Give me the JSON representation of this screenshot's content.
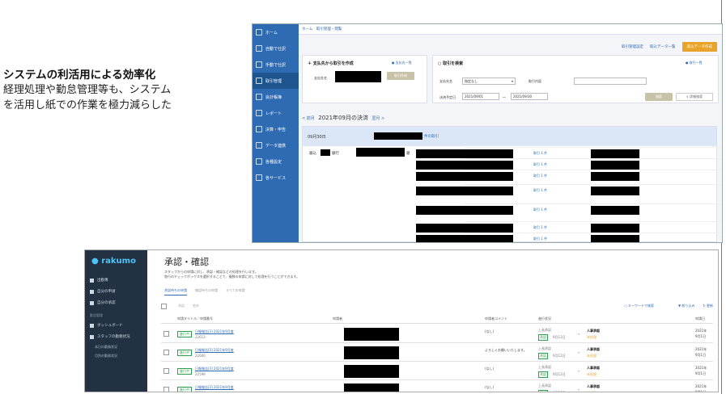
{
  "caption": {
    "title": "システムの利活用による効率化",
    "line1": "経理処理や勤怠管理等も、システム",
    "line2": "を活用し紙での作業を極力減らした"
  },
  "top": {
    "breadcrumb": "ホーム　取引管理・閲覧",
    "sidebar": [
      {
        "label": "ホーム",
        "icon": "home-icon"
      },
      {
        "label": "自動で仕訳",
        "icon": "auto-journal-icon"
      },
      {
        "label": "手動で仕訳",
        "icon": "manual-journal-icon"
      },
      {
        "label": "取引管理",
        "icon": "transactions-icon"
      },
      {
        "label": "会計帳簿",
        "icon": "ledger-icon"
      },
      {
        "label": "レポート",
        "icon": "report-icon"
      },
      {
        "label": "決算・申告",
        "icon": "closing-icon"
      },
      {
        "label": "データ連携",
        "icon": "data-link-icon"
      },
      {
        "label": "各種設定",
        "icon": "settings-icon"
      },
      {
        "label": "各サービス",
        "icon": "services-icon"
      }
    ],
    "actions": {
      "settings": "取引管理設定",
      "list": "取込データ一覧",
      "create": "取込データ作成"
    },
    "create_card": {
      "title": "支払先から取引を作成",
      "link": "支払先一覧",
      "field": "支払先名",
      "button": "取引作成"
    },
    "search_card": {
      "title": "取引を検索",
      "link": "取引一覧",
      "payee_label": "支払先名",
      "payee_value": "指定なし",
      "content_label": "取引内容",
      "date_label": "決済予定日",
      "date_from": "2021/09/01",
      "date_sep": "〜",
      "date_to": "2021/09/30",
      "search_btn": "検索",
      "detail_btn": "詳細検索"
    },
    "month": {
      "prev": "< 前月",
      "label": "2021年09月の決済",
      "next": "翌月 >"
    },
    "panel": {
      "date": "09月30日",
      "suffix": "件の取引",
      "payee_prefix": "銀込",
      "payee_mid": "銀行",
      "payee_suffix": "銀"
    },
    "counts": [
      "取引 1 件",
      "取引 1 件",
      "取引 1 件",
      "取引 1 件",
      "取引 1 件",
      "取引 1 件",
      "取引 1 件"
    ]
  },
  "bottom": {
    "logo": "rakumo",
    "sidebar": [
      "出勤簿",
      "自分の申請",
      "自分の承認"
    ],
    "section": "勤怠管理",
    "sidebar2": [
      "ダッシュボード",
      "スタッフの勤務状況"
    ],
    "subitems": [
      "本日の勤務状況",
      "月別の勤務状況"
    ],
    "title": "承認・確認",
    "desc1": "スタッフからの申請に対し、承認・確認などの処理を行います。",
    "desc2": "各行のチェックボックスを選択することで、複数の申請に対して処理を行うことができます。",
    "tabs": [
      "承認待ちの申請",
      "確認待ちの申請",
      "すべての申請"
    ],
    "tool": {
      "approve": "承認",
      "return": "差戻",
      "search": "キーワードで検索",
      "filter": "絞り込み",
      "refresh": "更新"
    },
    "headers": [
      "申請タイトル／申請番号",
      "申請者",
      "申請者コメント",
      "進行状況",
      "申請日"
    ],
    "rows": [
      {
        "status": "進行中",
        "title": "日報報告[3] 2021年9月度",
        "no": "22613",
        "comment": "(なし)",
        "from": "上長承認",
        "from_state": "承認",
        "from_date": "9月12日",
        "to": "人事承認",
        "to_state": "未処理",
        "date1": "2021年",
        "date2": "9月1日"
      },
      {
        "status": "進行中",
        "title": "日報報告[3] 2021年9月度",
        "no": "22600",
        "comment": "よろしくお願いいたします。",
        "from": "上長承認",
        "from_state": "承認",
        "from_date": "9月12日",
        "to": "人事承認",
        "to_state": "未処理",
        "date1": "2021年",
        "date2": "9月1日"
      },
      {
        "status": "進行中",
        "title": "日報報告[3] 2021年9月度",
        "no": "22599",
        "comment": "(なし)",
        "from": "上長承認",
        "from_state": "承認",
        "from_date": "9月12日",
        "to": "人事承認",
        "to_state": "未処理",
        "date1": "2021年",
        "date2": "9月1日"
      },
      {
        "status": "進行中",
        "title": "日報報告[3] 2021年9月度",
        "no": "22598",
        "comment": "(なし)",
        "from": "上長承認",
        "from_state": "承認",
        "from_date": "9月12日",
        "to": "人事承認",
        "to_state": "未処理",
        "date1": "2021年",
        "date2": "9月1日"
      }
    ]
  }
}
